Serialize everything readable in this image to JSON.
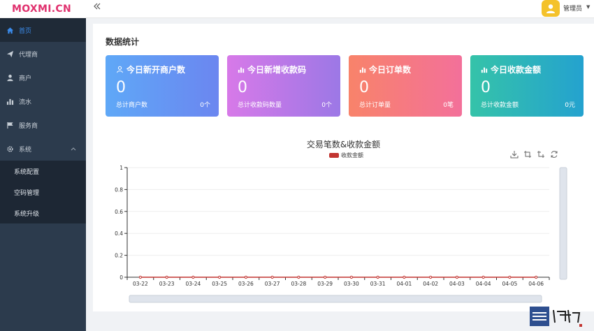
{
  "app": {
    "logo": "MOXMI.CN"
  },
  "header": {
    "collapse_icon": "double-chevron-left-icon",
    "user_name": "管理员",
    "user_caret": "▼"
  },
  "sidebar": {
    "items": [
      {
        "label": "首页",
        "icon": "home-icon",
        "active": true
      },
      {
        "label": "代理商",
        "icon": "paper-plane-icon"
      },
      {
        "label": "商户",
        "icon": "user-icon"
      },
      {
        "label": "流水",
        "icon": "bar-chart-icon"
      },
      {
        "label": "服务商",
        "icon": "flag-icon"
      },
      {
        "label": "系统",
        "icon": "gear-icon",
        "expanded": true,
        "children": [
          {
            "label": "系统配置"
          },
          {
            "label": "空码管理"
          },
          {
            "label": "系统升级"
          }
        ]
      }
    ]
  },
  "main": {
    "section_title": "数据统计",
    "cards": [
      {
        "title": "今日新开商户数",
        "icon": "user-outline-icon",
        "value": "0",
        "sub_label": "总计商户数",
        "sub_value": "0个"
      },
      {
        "title": "今日新增收款码",
        "icon": "bar-chart-icon",
        "value": "0",
        "sub_label": "总计收款码数量",
        "sub_value": "0个"
      },
      {
        "title": "今日订单数",
        "icon": "bar-chart-icon",
        "value": "0",
        "sub_label": "总计订单量",
        "sub_value": "0笔"
      },
      {
        "title": "今日收款金额",
        "icon": "bar-chart-icon",
        "value": "0",
        "sub_label": "总计收款金额",
        "sub_value": "0元"
      }
    ],
    "colors": {
      "card1": "#5fa8f7",
      "card2": "#c079e8",
      "card3": "#f6776f",
      "card4": "#2fb6bb",
      "series": "#c23531"
    }
  },
  "chart_data": {
    "type": "line",
    "title": "交易笔数&收款金额",
    "categories": [
      "03-22",
      "03-23",
      "03-24",
      "03-25",
      "03-26",
      "03-27",
      "03-28",
      "03-29",
      "03-30",
      "03-31",
      "04-01",
      "04-02",
      "04-03",
      "04-04",
      "04-05",
      "04-06"
    ],
    "series": [
      {
        "name": "收款金额",
        "values": [
          0,
          0,
          0,
          0,
          0,
          0,
          0,
          0,
          0,
          0,
          0,
          0,
          0,
          0,
          0,
          0
        ]
      }
    ],
    "yticks": [
      "0",
      "0.2",
      "0.4",
      "0.6",
      "0.8",
      "1"
    ],
    "ylim": [
      0,
      1
    ],
    "grid": true,
    "legend": "top-center",
    "toolbox": [
      "save-as-image-icon",
      "zoom-icon",
      "zoom-reset-icon",
      "restore-icon"
    ]
  }
}
